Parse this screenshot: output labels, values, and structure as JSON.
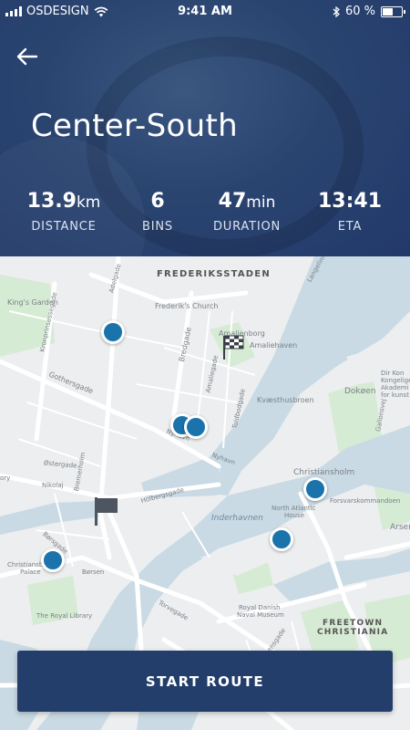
{
  "status_bar": {
    "carrier": "OSDESIGN",
    "time": "9:41 AM",
    "battery": "60 %",
    "battery_level": 0.6
  },
  "header": {
    "title": "Center-South"
  },
  "stats": [
    {
      "value": "13.9",
      "unit": "km",
      "label": "DISTANCE"
    },
    {
      "value": "6",
      "unit": "",
      "label": "BINS"
    },
    {
      "value": "47",
      "unit": "min",
      "label": "DURATION"
    },
    {
      "value": "13:41",
      "unit": "",
      "label": "ETA"
    }
  ],
  "map": {
    "labels": {
      "frederiksstaden": "FREDERIKSSTADEN",
      "kings_garden": "King's Garden",
      "frederiks_church": "Frederik's Church",
      "amalienborg": "Amalienborg",
      "amaliehaven": "Amaliehaven",
      "kvaesthusbroen": "Kvæsthusbroen",
      "dokoen": "Dokøen",
      "galionsvej": "Galionsvej",
      "christianshol": "Christiansholm",
      "forsvarskommandoen": "Forsvarskommandoen",
      "arsenal": "Arsena",
      "north_atlantic": "North Atlantic",
      "house": "House",
      "inderhavnen": "Inderhavnen",
      "royal_danish": "Royal Danish",
      "naval_museum": "Naval Museum",
      "freetown": "FREETOWN",
      "christiania": "CHRISTIANIA",
      "royal_library": "The Royal Library",
      "christiansborg": "Christiansbo",
      "palace": "Palace",
      "borsen": "Børsen",
      "nyhavn": "Nyhavn",
      "nyhavn2": "Nyhavn",
      "bredgade": "Bredgade",
      "gothersgade": "Gothersgade",
      "holbergsgade": "Holbergsgade",
      "bremerholm": "Bremerholm",
      "nikolaj": "Nikolaj",
      "ostergade": "Østergade",
      "kronprinsessegade": "Kronprinsessegade",
      "adelgade": "Adelgade",
      "amaliegade": "Amaliegade",
      "toldbodgade": "Toldbodgade",
      "borsgade": "Børsgade",
      "torvegade": "Torvegade",
      "langelinie": "Langelinie",
      "ory": "ory",
      "dir_kon": "Dir Kon",
      "for_hav": "for hav",
      "kongelige": "Kongelige",
      "akademi": "Akademi",
      "for_kunst": "for kunst",
      "galio2": "Gelionsvej",
      "strandgade": "Strandgade",
      "esensgade": "Esensgade"
    }
  },
  "actions": {
    "start_route": "START ROUTE"
  },
  "colors": {
    "header_bg": "#22396a",
    "button_bg": "#243e6b",
    "pin": "#1a73ab",
    "water": "#c5d7e2",
    "park": "#cfe8cf"
  }
}
